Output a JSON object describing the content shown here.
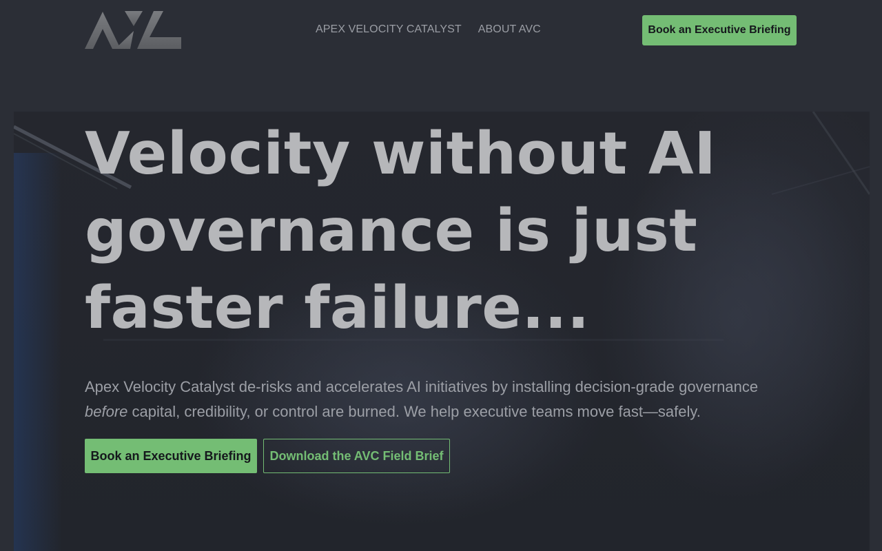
{
  "header": {
    "logo_text": "AVC",
    "nav": [
      {
        "label": "APEX VELOCITY CATALYST"
      },
      {
        "label": "ABOUT AVC"
      }
    ],
    "cta_label": "Book an Executive Briefing"
  },
  "hero": {
    "title": "Velocity without  AI governance is just faster failure...",
    "subtitle_before": "Apex Velocity Catalyst de-risks and accelerates AI initiatives by installing decision-grade governance ",
    "subtitle_emphasis": "before",
    "subtitle_after": " capital, credibility, or control are burned. We help executive teams move fast—safely.",
    "primary_cta": "Book an Executive Briefing",
    "secondary_cta": "Download the AVC Field Brief"
  },
  "colors": {
    "accent": "#74bd74",
    "page_bg": "#2b2e36",
    "hero_bg": "#23262d",
    "title_text": "#b6b7ba",
    "body_text": "#9c9fa6"
  }
}
